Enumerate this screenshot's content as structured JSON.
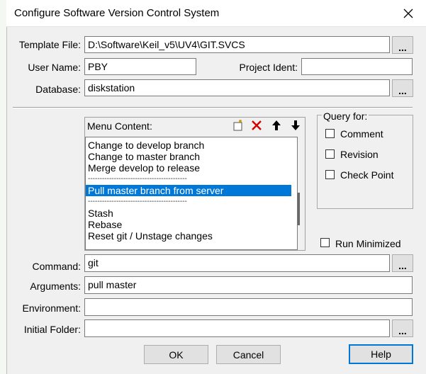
{
  "window": {
    "title": "Configure Software Version Control System"
  },
  "fields": {
    "template_file": {
      "label": "Template File:",
      "value": "D:\\Software\\Keil_v5\\UV4\\GIT.SVCS"
    },
    "user_name": {
      "label": "User Name:",
      "value": "PBY"
    },
    "project_ident": {
      "label": "Project Ident:",
      "value": ""
    },
    "database": {
      "label": "Database:",
      "value": "diskstation"
    },
    "command": {
      "label": "Command:",
      "value": "git"
    },
    "arguments": {
      "label": "Arguments:",
      "value": "pull master"
    },
    "environment": {
      "label": "Environment:",
      "value": ""
    },
    "initial_folder": {
      "label": "Initial Folder:",
      "value": ""
    }
  },
  "browse_label": "...",
  "menu": {
    "label": "Menu Content:",
    "items": [
      "Change to develop branch",
      "Change to master branch",
      "Merge develop to release",
      "------------------------------------------",
      "Pull master branch  from server",
      "------------------------------------------",
      "Stash",
      "Rebase",
      "Reset git / Unstage changes"
    ],
    "selected_index": 4
  },
  "query": {
    "label": "Query for:",
    "comment": "Comment",
    "revision": "Revision",
    "checkpoint": "Check Point"
  },
  "run_minimized": "Run Minimized",
  "buttons": {
    "ok": "OK",
    "cancel": "Cancel",
    "help": "Help"
  },
  "icons": [
    "close-icon",
    "new-item-icon",
    "delete-icon",
    "move-up-icon",
    "move-down-icon"
  ],
  "colors": {
    "selection": "#0078d7",
    "dialog_bg": "#f0f0f0",
    "delete_red": "#d40000"
  }
}
